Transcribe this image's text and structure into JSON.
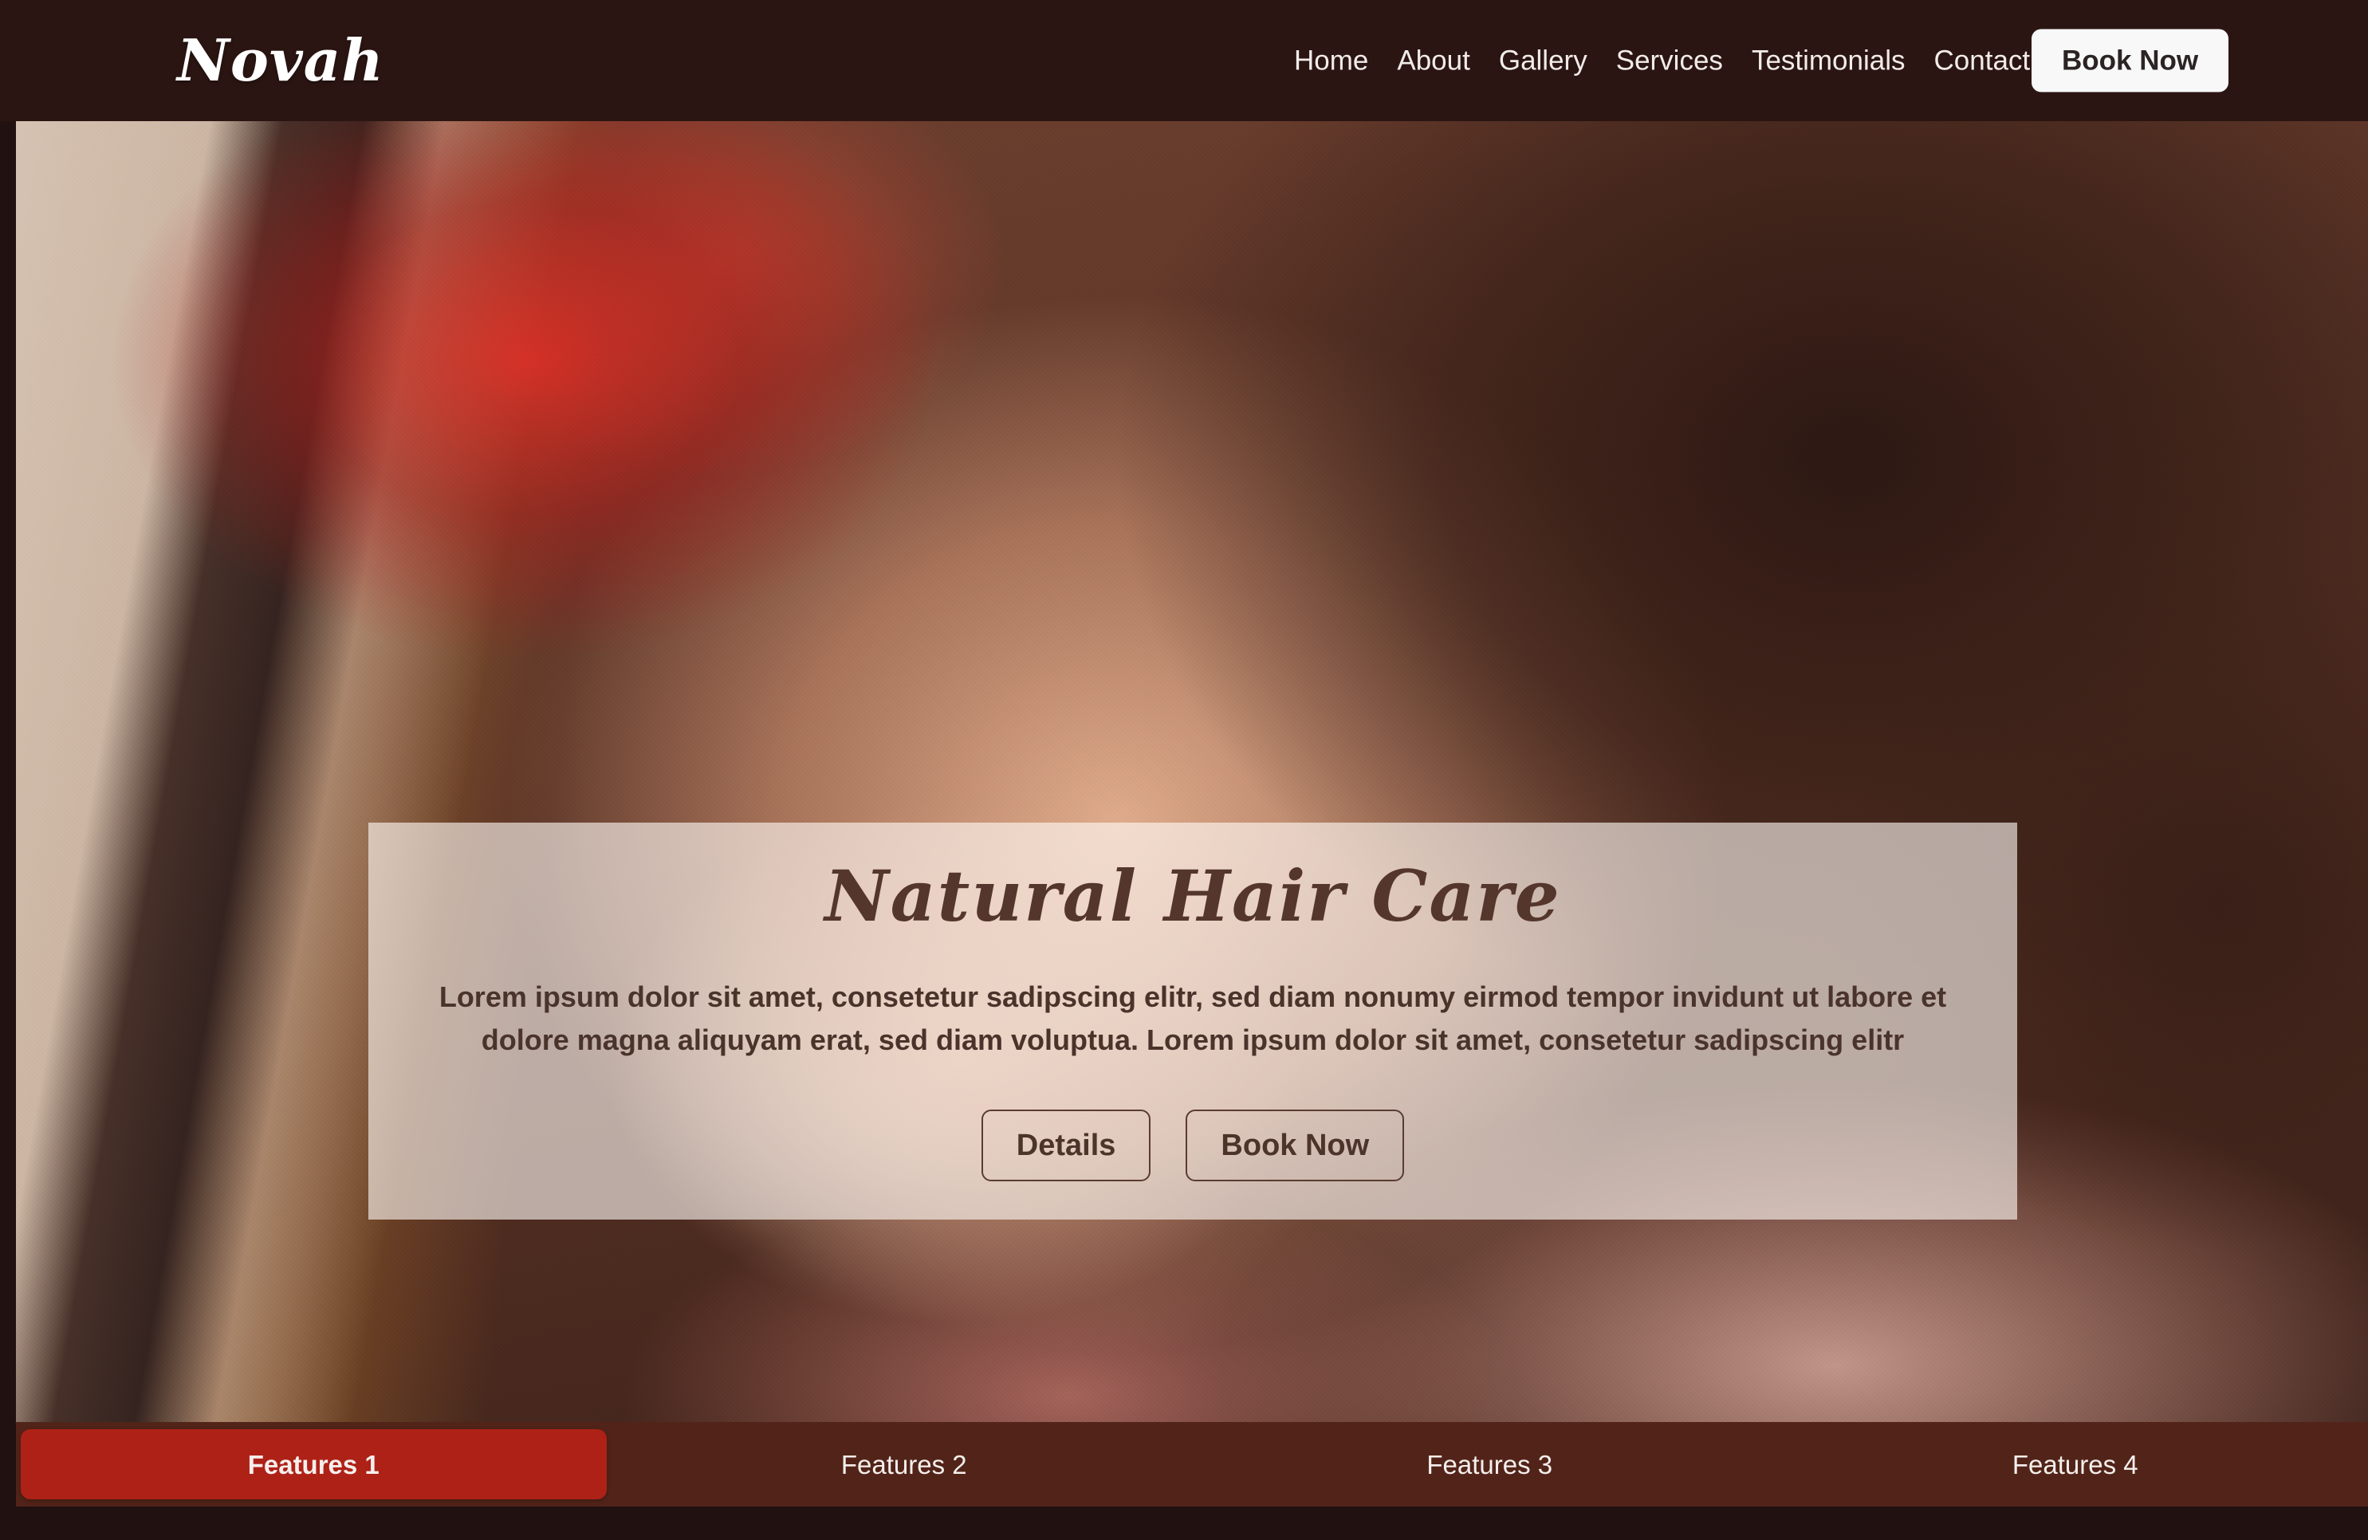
{
  "header": {
    "brand": "Novah",
    "nav": [
      {
        "label": "Home"
      },
      {
        "label": "About"
      },
      {
        "label": "Gallery"
      },
      {
        "label": "Services"
      },
      {
        "label": "Testimonials"
      },
      {
        "label": "Contact"
      }
    ],
    "cta_label": "Book Now"
  },
  "hero": {
    "title": "Natural Hair Care",
    "body": "Lorem ipsum dolor sit amet, consetetur sadipscing elitr, sed diam nonumy eirmod tempor invidunt ut labore et dolore magna aliquyam erat, sed diam voluptua. Lorem ipsum dolor sit amet, consetetur sadipscing elitr",
    "details_label": "Details",
    "book_label": "Book Now"
  },
  "features": {
    "tabs": [
      {
        "label": "Features 1",
        "active": true
      },
      {
        "label": "Features 2",
        "active": false
      },
      {
        "label": "Features 3",
        "active": false
      },
      {
        "label": "Features 4",
        "active": false
      }
    ]
  },
  "colors": {
    "header_bg": "#2b1512",
    "features_bar_bg": "#522419",
    "active_tab_bg": "#ae2117",
    "page_bg": "#211110",
    "panel_bg": "rgba(255,250,245,0.62)",
    "title_text": "#54362c",
    "body_text": "#4a332b",
    "cta_bg": "#f8f8f9",
    "cta_text": "#2b2324"
  }
}
